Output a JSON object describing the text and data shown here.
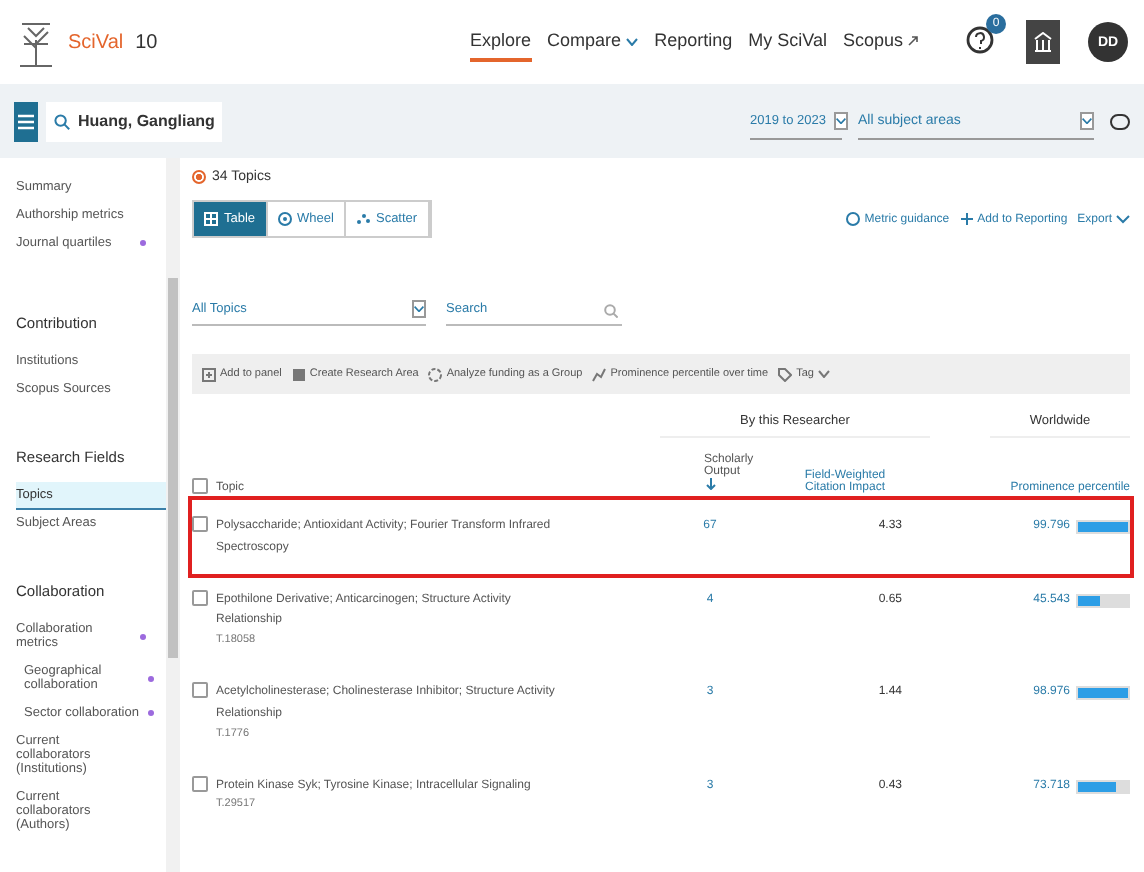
{
  "header": {
    "logo": "SciVal",
    "version": "10",
    "nav": [
      {
        "label": "Explore",
        "selected": true,
        "kind": "plain"
      },
      {
        "label": "Compare",
        "selected": false,
        "kind": "dropdown"
      },
      {
        "label": "Reporting",
        "selected": false,
        "kind": "plain"
      },
      {
        "label": "My SciVal",
        "selected": false,
        "kind": "plain"
      },
      {
        "label": "Scopus",
        "selected": false,
        "kind": "external"
      }
    ],
    "help_badge": "0",
    "avatar": "DD"
  },
  "toolbar": {
    "entity": "Huang, Gangliang",
    "years": "2019 to 2023",
    "subject": "All subject areas",
    "toggle_on": false
  },
  "sidebar": [
    {
      "items": [
        {
          "label": "Summary",
          "selected": false,
          "dot": false
        },
        {
          "label": "Authorship metrics",
          "selected": false,
          "dot": false
        },
        {
          "label": "Journal quartiles",
          "selected": false,
          "dot": true
        }
      ]
    },
    {
      "heading": "Contribution",
      "items": [
        {
          "label": "Institutions",
          "selected": false,
          "dot": false
        },
        {
          "label": "Scopus Sources",
          "selected": false,
          "dot": false
        }
      ]
    },
    {
      "heading": "Research Fields",
      "items": [
        {
          "label": "Topics",
          "selected": true,
          "dot": false
        },
        {
          "label": "Subject Areas",
          "selected": false,
          "dot": false
        }
      ]
    },
    {
      "heading": "Collaboration",
      "items": [
        {
          "label": "Collaboration metrics",
          "selected": false,
          "dot": true
        },
        {
          "label": "Geographical collaboration",
          "selected": false,
          "dot": true,
          "sub": true
        },
        {
          "label": "Sector collaboration",
          "selected": false,
          "dot": true,
          "sub": true
        },
        {
          "label": "Current collaborators (Institutions)",
          "selected": false,
          "dot": false
        },
        {
          "label": "Current collaborators (Authors)",
          "selected": false,
          "dot": false
        }
      ]
    }
  ],
  "main": {
    "radio": {
      "label": "34 Topics",
      "selected": true
    },
    "views": [
      {
        "label": "Table",
        "selected": true
      },
      {
        "label": "Wheel",
        "selected": false
      },
      {
        "label": "Scatter",
        "selected": false
      }
    ],
    "actions": [
      "Metric guidance",
      "Add to Reporting",
      "Export"
    ],
    "filter": "All Topics",
    "search_placeholder": "Search",
    "tools": [
      "Add to panel",
      "Create Research Area",
      "Analyze funding as a Group",
      "Prominence percentile over time",
      "Tag"
    ],
    "table": {
      "group_left": "By this Researcher",
      "group_right": "Worldwide",
      "header_checked": false,
      "columns": [
        "Topic",
        "Scholarly Output",
        "Field-Weighted Citation Impact",
        "Prominence percentile"
      ],
      "rows": [
        {
          "topic": "Polysaccharide; Antioxidant Activity; Fourier Transform Infrared Spectroscopy",
          "output": "67",
          "fwci": "4.33",
          "percentile": "99.796",
          "level": 1,
          "highlighted": true,
          "checked": false
        },
        {
          "topic": "Epothilone Derivative; Anticarcinogen; Structure Activity Relationship",
          "id": "T.18058",
          "output": "4",
          "fwci": "0.65",
          "percentile": "45.543",
          "level": 0.45,
          "highlighted": false,
          "checked": false
        },
        {
          "topic": "Acetylcholinesterase; Cholinesterase Inhibitor; Structure Activity Relationship",
          "id": "T.1776",
          "output": "3",
          "fwci": "1.44",
          "percentile": "98.976",
          "level": 0.99,
          "highlighted": false,
          "checked": false
        },
        {
          "topic": "Protein Kinase Syk; Tyrosine Kinase; Intracellular Signaling",
          "id": "T.29517",
          "output": "3",
          "fwci": "0.43",
          "percentile": "73.718",
          "level": 0.74,
          "highlighted": false,
          "checked": false
        }
      ]
    }
  }
}
